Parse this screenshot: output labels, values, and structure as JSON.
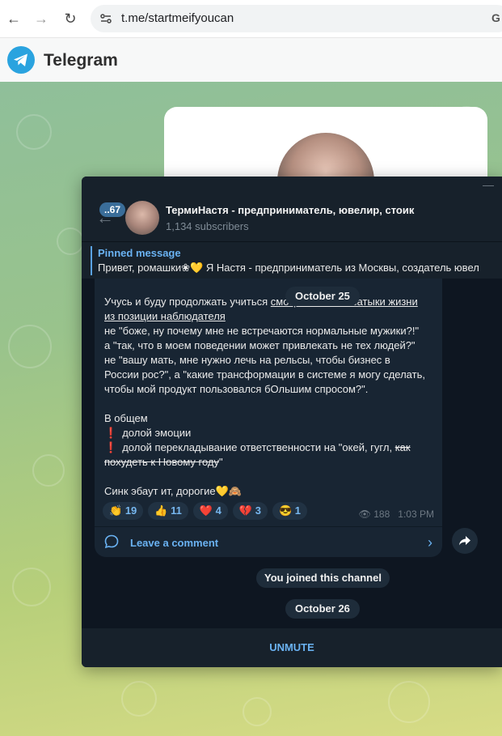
{
  "browser": {
    "url": "t.me/startmeifyoucan",
    "translate_icon": "G"
  },
  "app": {
    "title": "Telegram"
  },
  "channel": {
    "title": "ТермиНастя - предприниматель, ювелир, стоик",
    "subscribers": "1,134 subscribers",
    "unread_count": "..67"
  },
  "pinned": {
    "title": "Pinned message",
    "text": "Привет, ромашки❀💛 Я Настя - предприниматель из Москвы, создатель ювел"
  },
  "message": {
    "date": "October 25",
    "lines": {
      "l1a": "Учусь и буду продолжать учиться ",
      "l1b": "смотреть на все затыки жизни",
      "l2": "из позиции наблюдателя",
      "l3": "не \"боже, ну почему мне не встречаются нормальные мужики?!\"",
      "l4": "а \"так, что в моем поведении может привлекать не тех людей?\"",
      "l5": "не \"вашу мать, мне нужно лечь на рельсы, чтобы бизнес в",
      "l6": "России рос?\", а \"какие трансформации в системе я могу сделать,",
      "l7": "чтобы мой продукт пользовался бОльшим спросом?\".",
      "l8": "В общем",
      "l9": "долой эмоции",
      "l10a": "долой перекладывание ответственности на \"окей, гугл, ",
      "l10b": "как",
      "l11a": "похудеть к Новому году",
      "l11b": "\"",
      "l12": "Синк эбаут ит, дорогие💛🙈"
    },
    "reactions": [
      {
        "emoji": "👏",
        "count": "19"
      },
      {
        "emoji": "👍",
        "count": "11"
      },
      {
        "emoji": "❤️",
        "count": "4"
      },
      {
        "emoji": "💔",
        "count": "3"
      },
      {
        "emoji": "😎",
        "count": "1"
      }
    ],
    "views": "188",
    "time": "1:03 PM",
    "comment_label": "Leave a comment"
  },
  "service_messages": {
    "joined": "You joined this channel",
    "date2": "October 26"
  },
  "footer": {
    "unmute_label": "UNMUTE"
  },
  "colors": {
    "accent": "#6ab2f2",
    "bubble": "#182533",
    "chat_bg": "#0e1621"
  }
}
